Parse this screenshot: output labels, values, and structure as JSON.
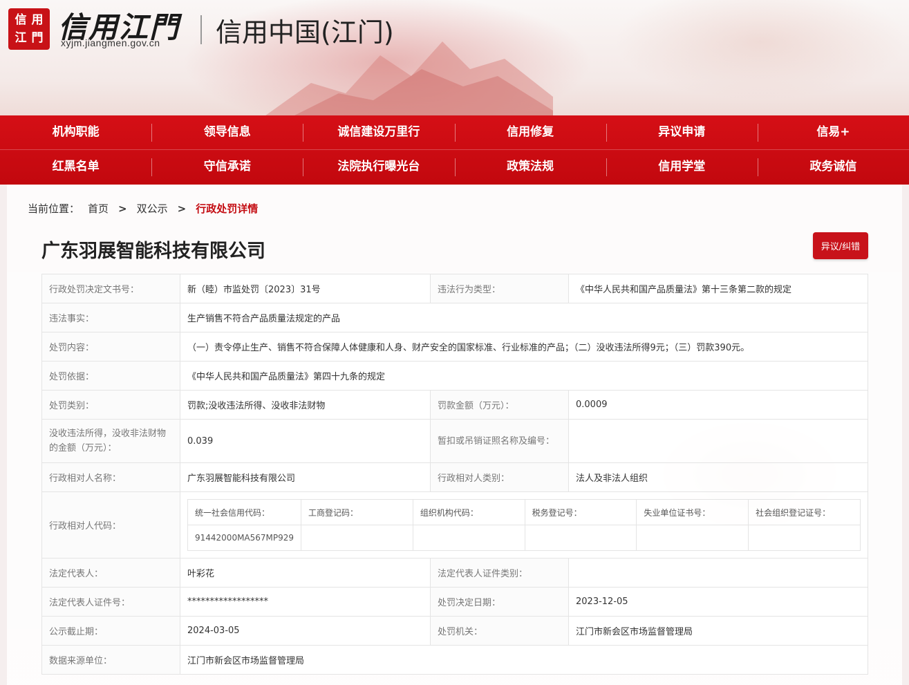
{
  "header": {
    "seal_chars": [
      "信",
      "用",
      "江",
      "門"
    ],
    "logo_text": "信用江門",
    "domain": "xyjm.jiangmen.gov.cn",
    "site_title": "信用中国(江门)"
  },
  "nav": {
    "row1": [
      "机构职能",
      "领导信息",
      "诚信建设万里行",
      "信用修复",
      "异议申请",
      "信易+"
    ],
    "row2": [
      "红黑名单",
      "守信承诺",
      "法院执行曝光台",
      "政策法规",
      "信用学堂",
      "政务诚信"
    ]
  },
  "breadcrumb": {
    "lead": "当前位置：",
    "home": "首页",
    "sep": ">",
    "section": "双公示",
    "current": "行政处罚详情"
  },
  "company_name": "广东羽展智能科技有限公司",
  "objection_button": "异议/纠错",
  "detail": {
    "doc_no_label": "行政处罚决定文书号：",
    "doc_no": "新（睦）市监处罚〔2023〕31号",
    "violation_type_label": "违法行为类型：",
    "violation_type": "《中华人民共和国产品质量法》第十三条第二款的规定",
    "facts_label": "违法事实：",
    "facts": "生产销售不符合产品质量法规定的产品",
    "content_label": "处罚内容：",
    "content": "（一）责令停止生产、销售不符合保障人体健康和人身、财产安全的国家标准、行业标准的产品；（二）没收违法所得9元；（三）罚款390元。",
    "basis_label": "处罚依据：",
    "basis": "《中华人民共和国产品质量法》第四十九条的规定",
    "category_label": "处罚类别：",
    "category": "罚款;没收违法所得、没收非法财物",
    "fine_label": "罚款金额（万元）：",
    "fine": "0.0009",
    "confiscation_label": "没收违法所得，没收非法财物的金额（万元）：",
    "confiscation": "0.039",
    "license_label": "暂扣或吊销证照名称及编号：",
    "license": "",
    "party_name_label": "行政相对人名称：",
    "party_name": "广东羽展智能科技有限公司",
    "party_type_label": "行政相对人类别：",
    "party_type": "法人及非法人组织",
    "party_code_label": "行政相对人代码：",
    "codes": {
      "headers": [
        "统一社会信用代码：",
        "工商登记码：",
        "组织机构代码：",
        "税务登记号：",
        "失业单位证书号：",
        "社会组织登记证号："
      ],
      "values": [
        "91442000MA567MP929",
        "",
        "",
        "",
        "",
        ""
      ]
    },
    "legal_rep_label": "法定代表人：",
    "legal_rep": "叶彩花",
    "legal_rep_id_type_label": "法定代表人证件类别：",
    "legal_rep_id_type": "",
    "legal_rep_id_label": "法定代表人证件号：",
    "legal_rep_id": "******************",
    "decision_date_label": "处罚决定日期：",
    "decision_date": "2023-12-05",
    "deadline_label": "公示截止期：",
    "deadline": "2024-03-05",
    "authority_label": "处罚机关：",
    "authority": "江门市新会区市场监督管理局",
    "source_label": "数据来源单位：",
    "source": "江门市新会区市场监督管理局"
  }
}
